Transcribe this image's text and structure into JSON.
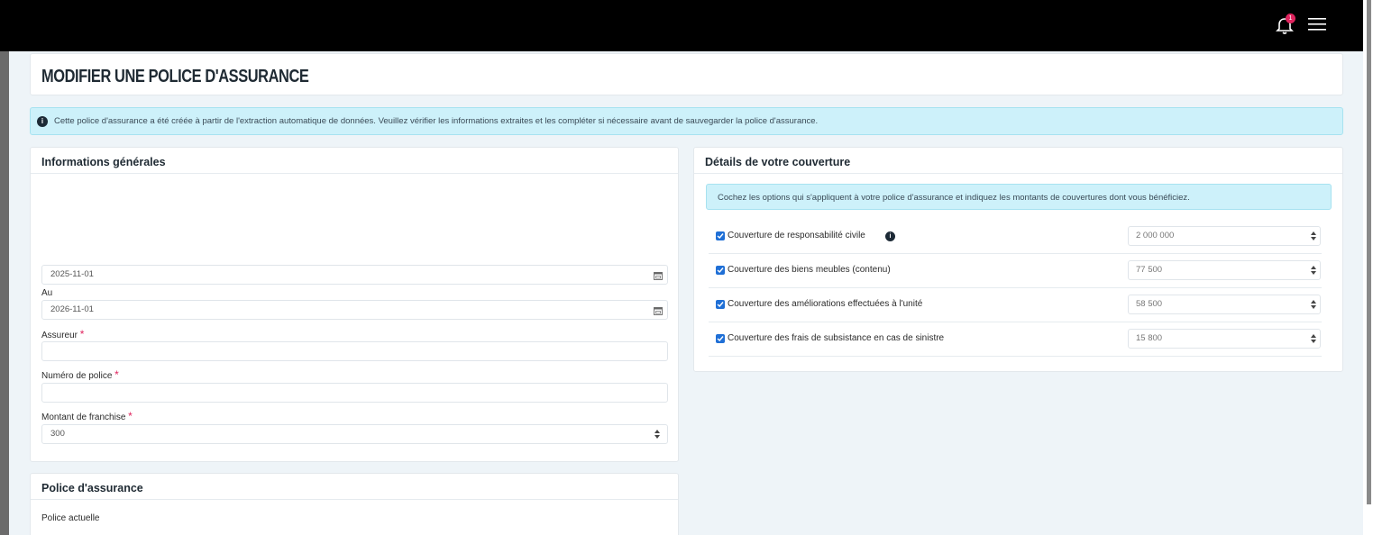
{
  "page": {
    "title": "MODIFIER UNE POLICE D'ASSURANCE",
    "notifications_count": "1"
  },
  "alert": {
    "text": "Cette police d'assurance a été créée à partir de l'extraction automatique de données. Veuillez vérifier les informations extraites et les compléter si nécessaire avant de sauvegarder la police d'assurance."
  },
  "general": {
    "title": "Informations générales",
    "start_date": "2025-11-01",
    "to_label": "Au",
    "end_date": "2026-11-01",
    "insurer_label": "Assureur",
    "insurer_value": "",
    "policy_number_label": "Numéro de police",
    "policy_number_value": "",
    "deductible_label": "Montant de franchise",
    "deductible_value": "300",
    "required_mark": "*"
  },
  "coverage": {
    "title": "Détails de votre couverture",
    "hint": "Cochez les options qui s'appliquent à votre police d'assurance et indiquez les montants de couvertures dont vous bénéficiez.",
    "items": [
      {
        "label": "Couverture de responsabilité civile",
        "value": "2 000 000",
        "checked": true,
        "has_info": true
      },
      {
        "label": "Couverture des biens meubles (contenu)",
        "value": "77 500",
        "checked": true,
        "has_info": false
      },
      {
        "label": "Couverture des améliorations effectuées à l'unité",
        "value": "58 500",
        "checked": true,
        "has_info": false
      },
      {
        "label": "Couverture des frais de subsistance en cas de sinistre",
        "value": "15 800",
        "checked": true,
        "has_info": false
      }
    ]
  },
  "policy": {
    "title": "Police d'assurance",
    "current_label": "Police actuelle"
  }
}
